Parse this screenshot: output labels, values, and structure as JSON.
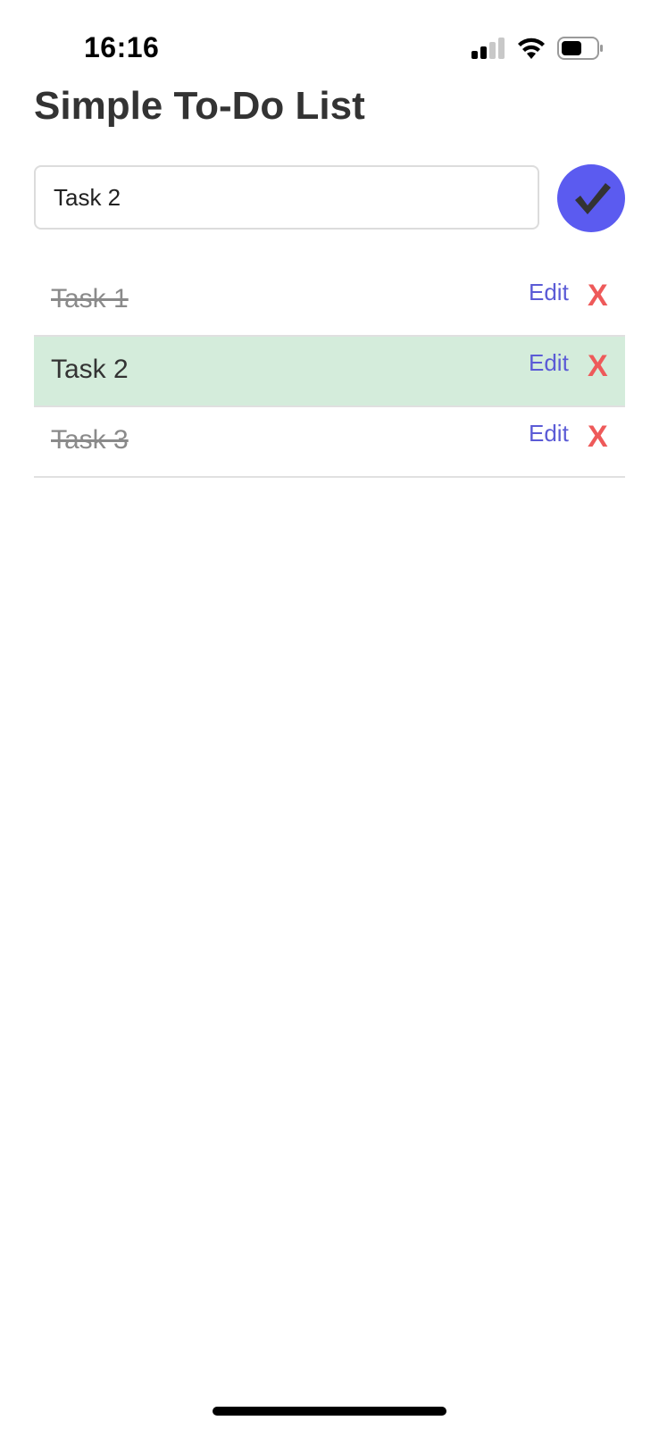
{
  "status_bar": {
    "time": "16:16",
    "signal_icon": "cellular-signal-icon",
    "wifi_icon": "wifi-icon",
    "battery_icon": "battery-icon"
  },
  "title": "Simple To-Do List",
  "input": {
    "value": "Task 2",
    "placeholder": ""
  },
  "submit": {
    "icon": "checkmark-icon",
    "color": "#5b5bf0"
  },
  "tasks": [
    {
      "text": "Task 1",
      "completed": true,
      "selected": false,
      "edit_label": "Edit",
      "delete_label": "X"
    },
    {
      "text": "Task 2",
      "completed": false,
      "selected": true,
      "edit_label": "Edit",
      "delete_label": "X"
    },
    {
      "text": "Task 3",
      "completed": true,
      "selected": false,
      "edit_label": "Edit",
      "delete_label": "X"
    }
  ],
  "colors": {
    "accent": "#5b5bf0",
    "selected_row": "#d4ecdb",
    "delete": "#ee5a5a",
    "edit": "#5b5bd6"
  }
}
